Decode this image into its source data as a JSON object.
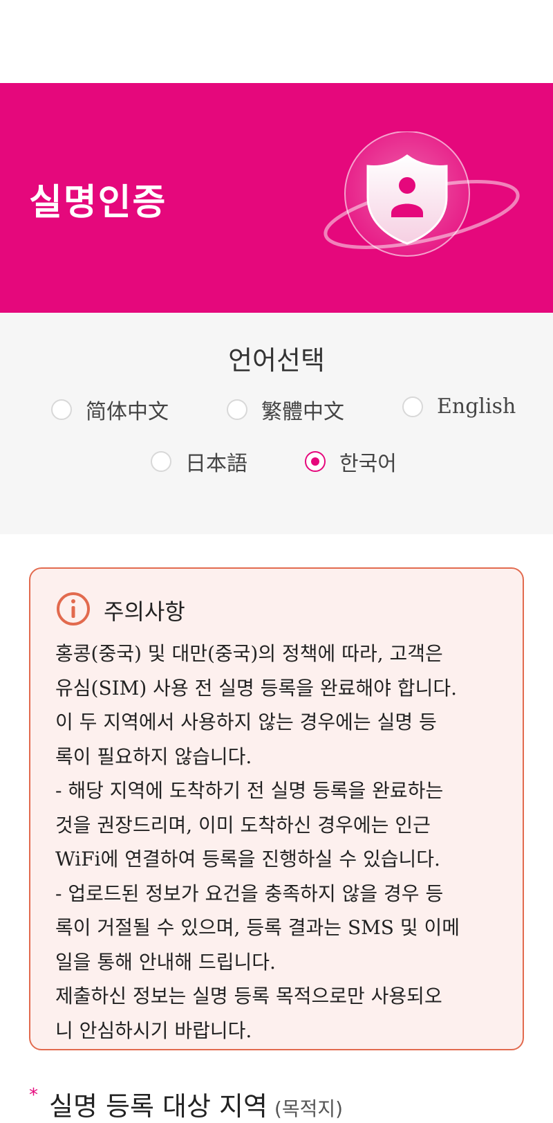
{
  "banner": {
    "title": "실명인증",
    "brand_color": "#e5087c",
    "icon": "shield-user-icon"
  },
  "language": {
    "title": "언어선택",
    "options": [
      {
        "label": "简体中文",
        "selected": false
      },
      {
        "label": "繁體中文",
        "selected": false
      },
      {
        "label": "English",
        "selected": false
      },
      {
        "label": "日本語",
        "selected": false
      },
      {
        "label": "한국어",
        "selected": true
      }
    ]
  },
  "notice": {
    "title": "주의사항",
    "icon": "info-icon",
    "accent_color": "#e26a4e",
    "lines": [
      "홍콩(중국) 및 대만(중국)의 정책에 따라, 고객은",
      "유심(SIM) 사용 전 실명 등록을 완료해야 합니다.",
      "이 두 지역에서 사용하지 않는 경우에는 실명 등",
      "록이 필요하지 않습니다.",
      "- 해당 지역에 도착하기 전 실명 등록을 완료하는",
      "것을 권장드리며, 이미 도착하신 경우에는 인근",
      "WiFi에 연결하여 등록을 진행하실 수 있습니다.",
      "- 업로드된 정보가 요건을 충족하지 않을 경우 등",
      "록이 거절될 수 있으며, 등록 결과는 SMS 및 이메",
      "일을 통해 안내해 드립니다.",
      "제출하신 정보는 실명 등록 목적으로만 사용되오",
      "니 안심하시기 바랍니다."
    ]
  },
  "target_region": {
    "required_mark": "*",
    "label": "실명 등록 대상 지역",
    "sub": "(목적지)"
  }
}
